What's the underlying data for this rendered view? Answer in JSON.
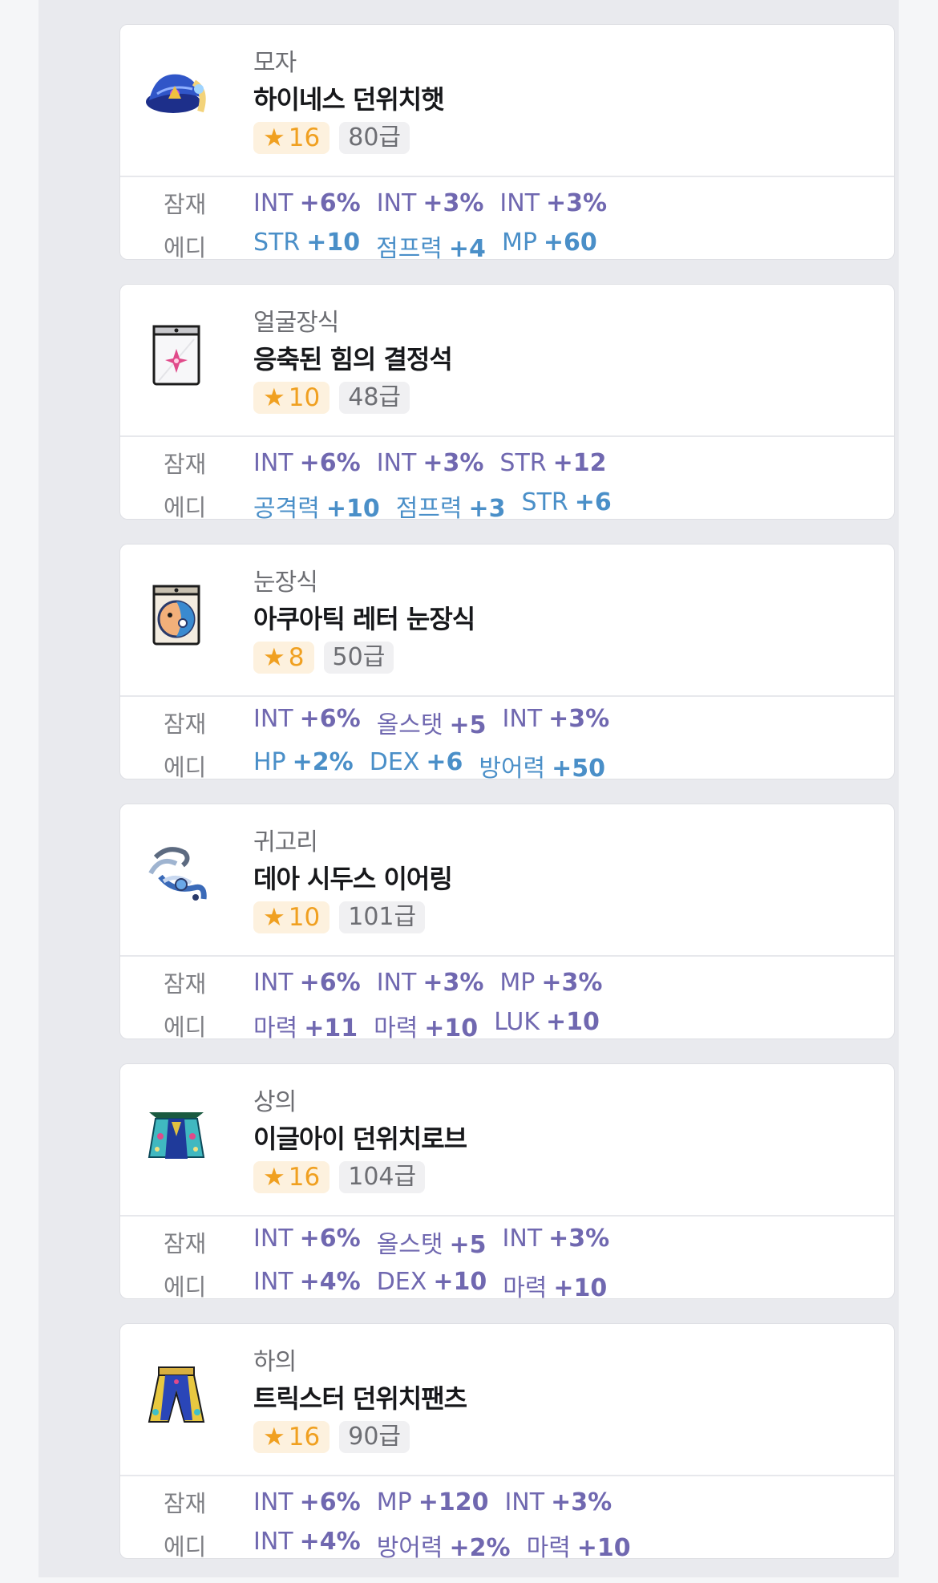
{
  "items": [
    {
      "slot": "모자",
      "name": "하이네스 던위치햇",
      "icon": "wizard-hat-icon",
      "star": "16",
      "level": "80급",
      "potential_label": "잠재",
      "potential": [
        {
          "stat": "INT",
          "val": "+6%"
        },
        {
          "stat": "INT",
          "val": "+3%"
        },
        {
          "stat": "INT",
          "val": "+3%"
        }
      ],
      "additional_label": "에디",
      "additional_color": "blue",
      "additional": [
        {
          "stat": "STR",
          "val": "+10"
        },
        {
          "stat": "점프력",
          "val": "+4"
        },
        {
          "stat": "MP",
          "val": "+60"
        }
      ]
    },
    {
      "slot": "얼굴장식",
      "name": "응축된 힘의 결정석",
      "icon": "crystal-card-icon",
      "star": "10",
      "level": "48급",
      "potential_label": "잠재",
      "potential": [
        {
          "stat": "INT",
          "val": "+6%"
        },
        {
          "stat": "INT",
          "val": "+3%"
        },
        {
          "stat": "STR",
          "val": "+12"
        }
      ],
      "additional_label": "에디",
      "additional_color": "blue",
      "additional": [
        {
          "stat": "공격력",
          "val": "+10"
        },
        {
          "stat": "점프력",
          "val": "+3"
        },
        {
          "stat": "STR",
          "val": "+6"
        }
      ]
    },
    {
      "slot": "눈장식",
      "name": "아쿠아틱 레터 눈장식",
      "icon": "aquatic-letter-icon",
      "star": "8",
      "level": "50급",
      "potential_label": "잠재",
      "potential": [
        {
          "stat": "INT",
          "val": "+6%"
        },
        {
          "stat": "올스탯",
          "val": "+5"
        },
        {
          "stat": "INT",
          "val": "+3%"
        }
      ],
      "additional_label": "에디",
      "additional_color": "blue",
      "additional": [
        {
          "stat": "HP",
          "val": "+2%"
        },
        {
          "stat": "DEX",
          "val": "+6"
        },
        {
          "stat": "방어력",
          "val": "+50"
        }
      ]
    },
    {
      "slot": "귀고리",
      "name": "데아 시두스 이어링",
      "icon": "earring-icon",
      "star": "10",
      "level": "101급",
      "potential_label": "잠재",
      "potential": [
        {
          "stat": "INT",
          "val": "+6%"
        },
        {
          "stat": "INT",
          "val": "+3%"
        },
        {
          "stat": "MP",
          "val": "+3%"
        }
      ],
      "additional_label": "에디",
      "additional_color": "purple",
      "additional": [
        {
          "stat": "마력",
          "val": "+11"
        },
        {
          "stat": "마력",
          "val": "+10"
        },
        {
          "stat": "LUK",
          "val": "+10"
        }
      ]
    },
    {
      "slot": "상의",
      "name": "이글아이 던위치로브",
      "icon": "robe-icon",
      "star": "16",
      "level": "104급",
      "potential_label": "잠재",
      "potential": [
        {
          "stat": "INT",
          "val": "+6%"
        },
        {
          "stat": "올스탯",
          "val": "+5"
        },
        {
          "stat": "INT",
          "val": "+3%"
        }
      ],
      "additional_label": "에디",
      "additional_color": "purple",
      "additional": [
        {
          "stat": "INT",
          "val": "+4%"
        },
        {
          "stat": "DEX",
          "val": "+10"
        },
        {
          "stat": "마력",
          "val": "+10"
        }
      ]
    },
    {
      "slot": "하의",
      "name": "트릭스터 던위치팬츠",
      "icon": "pants-icon",
      "star": "16",
      "level": "90급",
      "potential_label": "잠재",
      "potential": [
        {
          "stat": "INT",
          "val": "+6%"
        },
        {
          "stat": "MP",
          "val": "+120"
        },
        {
          "stat": "INT",
          "val": "+3%"
        }
      ],
      "additional_label": "에디",
      "additional_color": "purple",
      "additional": [
        {
          "stat": "INT",
          "val": "+4%"
        },
        {
          "stat": "방어력",
          "val": "+2%"
        },
        {
          "stat": "마력",
          "val": "+10"
        }
      ]
    }
  ],
  "colors": {
    "star": "#f0a020",
    "potential": "#7068b0",
    "additional_blue": "#4a8fc8"
  }
}
